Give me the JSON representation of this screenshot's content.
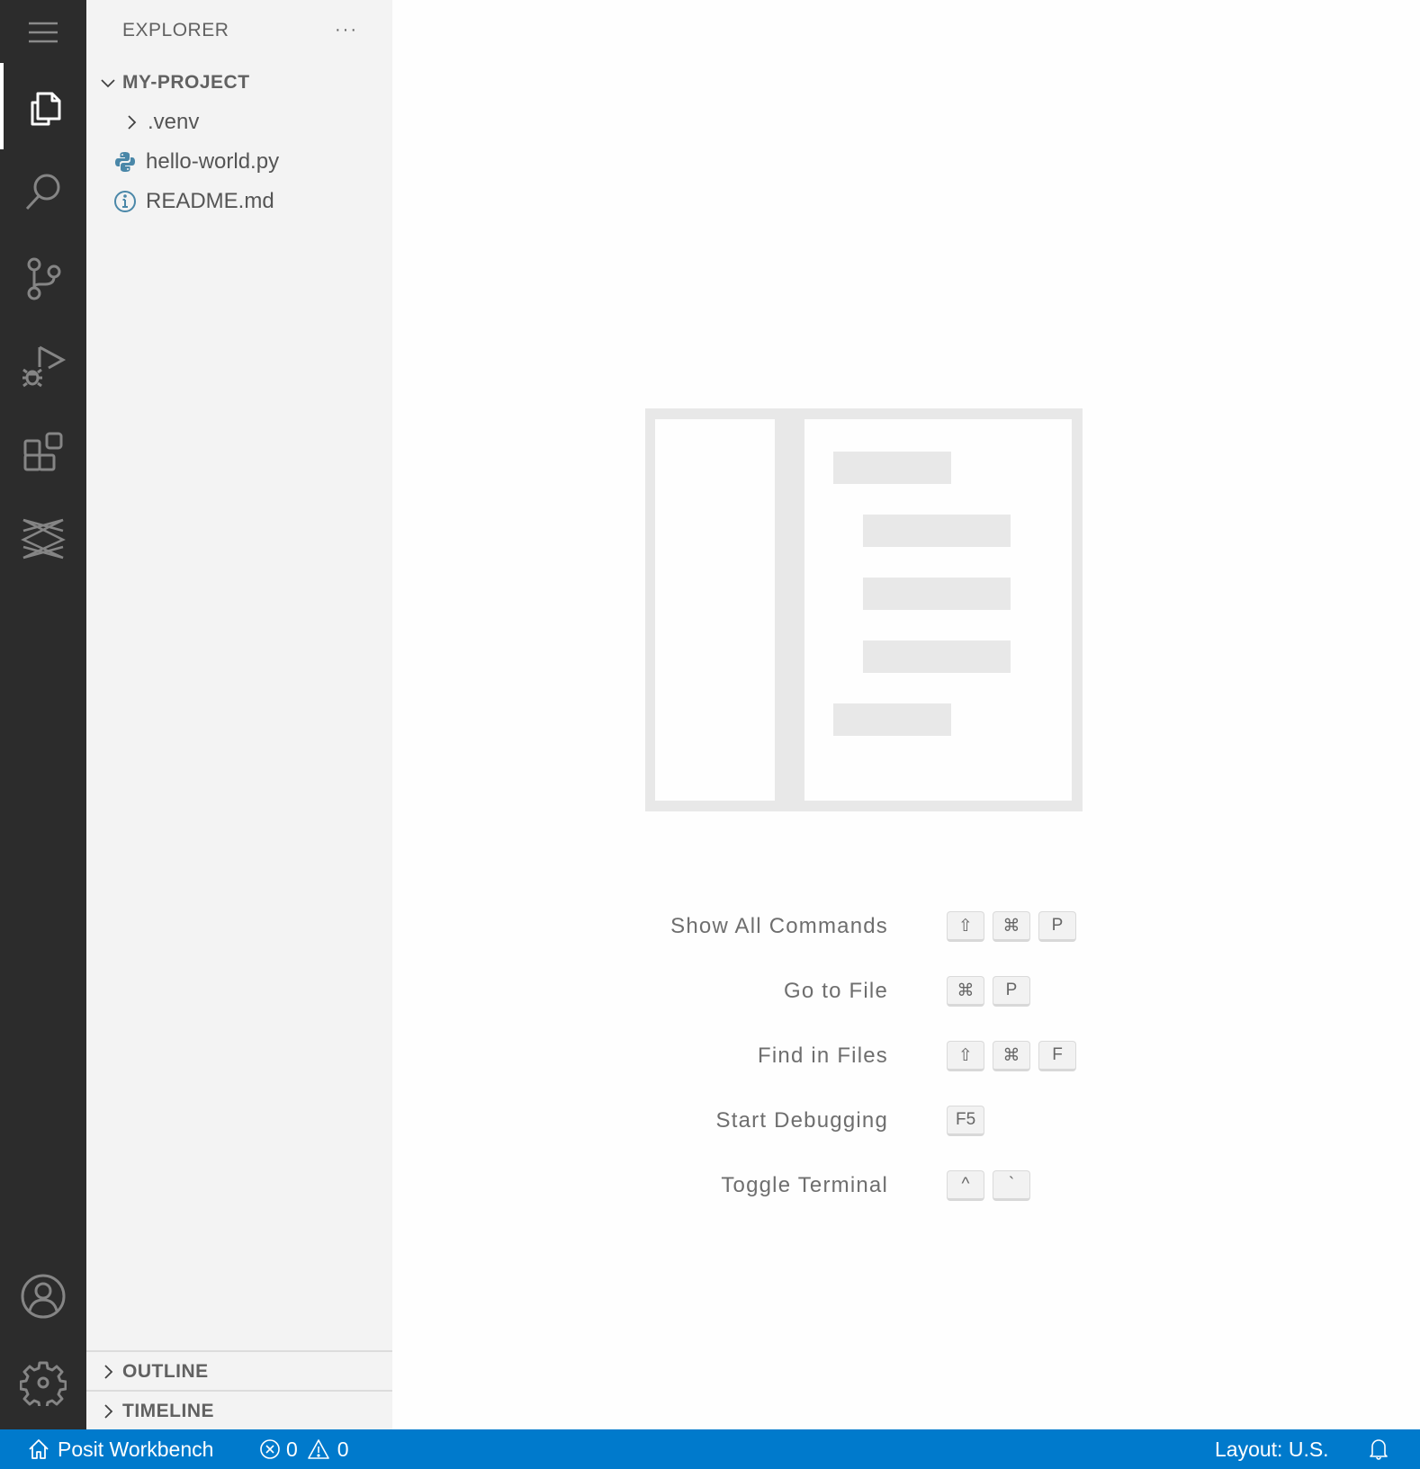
{
  "activity_bar": {
    "items": [
      {
        "name": "menu",
        "icon": "hamburger-menu-icon"
      },
      {
        "name": "explorer",
        "icon": "files-icon",
        "active": true
      },
      {
        "name": "search",
        "icon": "search-icon"
      },
      {
        "name": "source-control",
        "icon": "source-control-icon"
      },
      {
        "name": "run-and-debug",
        "icon": "run-debug-icon"
      },
      {
        "name": "extensions",
        "icon": "extensions-icon"
      },
      {
        "name": "posit",
        "icon": "posit-workbench-icon"
      }
    ],
    "bottom_items": [
      {
        "name": "accounts",
        "icon": "account-icon"
      },
      {
        "name": "manage",
        "icon": "gear-icon"
      }
    ]
  },
  "sidebar": {
    "title": "EXPLORER",
    "more_actions": "···",
    "project": {
      "name": "MY-PROJECT",
      "expanded": true,
      "items": [
        {
          "label": ".venv",
          "type": "folder",
          "icon": "chevron-right-icon"
        },
        {
          "label": "hello-world.py",
          "type": "file",
          "icon": "python-icon"
        },
        {
          "label": "README.md",
          "type": "file",
          "icon": "info-icon"
        }
      ]
    },
    "panes": [
      {
        "label": "OUTLINE",
        "expanded": false
      },
      {
        "label": "TIMELINE",
        "expanded": false
      }
    ]
  },
  "editor": {
    "shortcuts": [
      {
        "label": "Show All Commands",
        "keys": [
          "⇧",
          "⌘",
          "P"
        ]
      },
      {
        "label": "Go to File",
        "keys": [
          "⌘",
          "P"
        ]
      },
      {
        "label": "Find in Files",
        "keys": [
          "⇧",
          "⌘",
          "F"
        ]
      },
      {
        "label": "Start Debugging",
        "keys": [
          "F5"
        ]
      },
      {
        "label": "Toggle Terminal",
        "keys": [
          "^",
          "`"
        ]
      }
    ]
  },
  "status_bar": {
    "remote_label": "Posit Workbench",
    "errors": "0",
    "warnings": "0",
    "layout_label": "Layout: U.S.",
    "background": "#007acc"
  }
}
